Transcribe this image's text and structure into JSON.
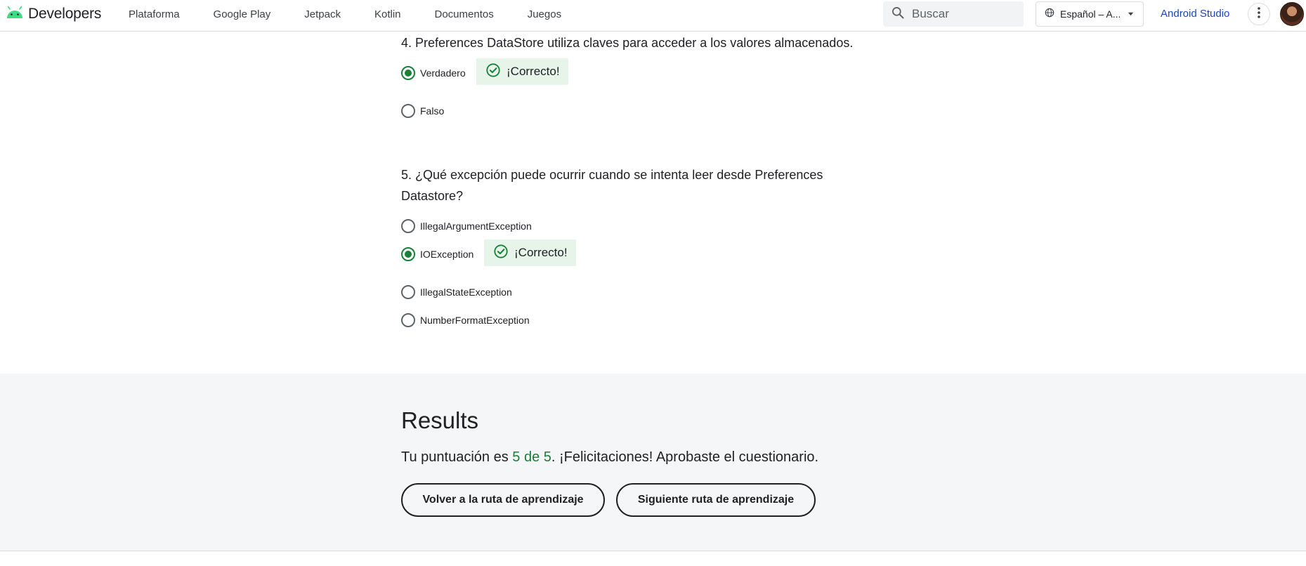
{
  "header": {
    "logo_text": "Developers",
    "nav": [
      {
        "label": "Plataforma"
      },
      {
        "label": "Google Play"
      },
      {
        "label": "Jetpack"
      },
      {
        "label": "Kotlin"
      },
      {
        "label": "Documentos"
      },
      {
        "label": "Juegos"
      }
    ],
    "search_placeholder": "Buscar",
    "language": "Español – A...",
    "studio_link": "Android Studio"
  },
  "questions": [
    {
      "title": "4. Preferences DataStore utiliza claves para acceder a los valores almacenados.",
      "options": [
        {
          "label": "Verdadero",
          "selected": true
        },
        {
          "label": "Falso",
          "selected": false
        }
      ],
      "feedback": "¡Correcto!"
    },
    {
      "title": "5. ¿Qué excepción puede ocurrir cuando se intenta leer desde Preferences Datastore?",
      "options": [
        {
          "label": "IllegalArgumentException",
          "selected": false
        },
        {
          "label": "IOException",
          "selected": true
        },
        {
          "label": "IllegalStateException",
          "selected": false
        },
        {
          "label": "NumberFormatException",
          "selected": false
        }
      ],
      "feedback": "¡Correcto!"
    }
  ],
  "results": {
    "title": "Results",
    "text_prefix": "Tu puntuación es ",
    "score": "5 de 5",
    "text_suffix": ". ¡Felicitaciones! Aprobaste el cuestionario.",
    "back_button": "Volver a la ruta de aprendizaje",
    "next_button": "Siguiente ruta de aprendizaje"
  },
  "colors": {
    "correct_green": "#188038",
    "feedback_bg": "#e6f4ea",
    "link_blue": "#1a47b8",
    "results_bg": "#f5f6f7"
  },
  "icons": [
    "android-logo-icon",
    "search-icon",
    "globe-icon",
    "caret-down-icon",
    "more-vert-icon",
    "check-circle-icon"
  ]
}
